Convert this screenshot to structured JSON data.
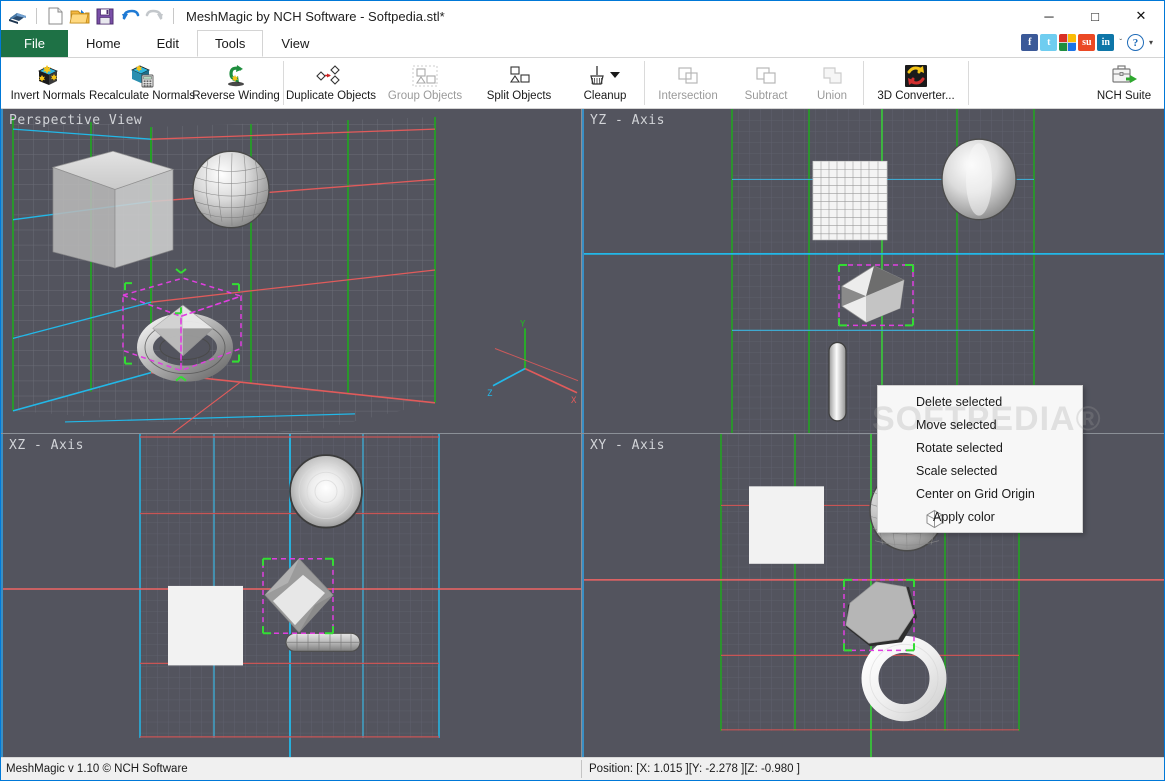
{
  "window": {
    "title": "MeshMagic by NCH Software - Softpedia.stl*",
    "minimize_label": "─",
    "maximize_label": "□",
    "close_label": "✕"
  },
  "quick_access": [
    {
      "name": "app-logo-icon",
      "label": "MeshMagic"
    },
    {
      "name": "new-file-icon",
      "label": "New"
    },
    {
      "name": "open-file-icon",
      "label": "Open"
    },
    {
      "name": "save-file-icon",
      "label": "Save"
    },
    {
      "name": "undo-icon",
      "label": "Undo"
    },
    {
      "name": "redo-icon",
      "label": "Redo"
    }
  ],
  "tabs": [
    {
      "label": "File",
      "active": false,
      "kind": "file"
    },
    {
      "label": "Home",
      "active": false,
      "kind": "normal"
    },
    {
      "label": "Edit",
      "active": false,
      "kind": "normal"
    },
    {
      "label": "Tools",
      "active": true,
      "kind": "normal"
    },
    {
      "label": "View",
      "active": false,
      "kind": "normal"
    }
  ],
  "social_buttons": [
    {
      "name": "facebook-icon",
      "label": "f"
    },
    {
      "name": "twitter-icon",
      "label": "t"
    },
    {
      "name": "googleplus-icon",
      "label": "+"
    },
    {
      "name": "stumbleupon-icon",
      "label": "su"
    },
    {
      "name": "linkedin-icon",
      "label": "in"
    }
  ],
  "social_overflow_label": "ˇ",
  "help_label": "?",
  "help_dropdown_label": "▾",
  "ribbon": {
    "groups": [
      {
        "name": "normals-group",
        "items": [
          {
            "label": "Invert Normals",
            "icon": "invert-normals-icon",
            "disabled": false
          },
          {
            "label": "Recalculate Normals",
            "icon": "recalculate-normals-icon",
            "disabled": false
          },
          {
            "label": "Reverse Winding",
            "icon": "reverse-winding-icon",
            "disabled": false
          }
        ]
      },
      {
        "name": "objects-group",
        "items": [
          {
            "label": "Duplicate Objects",
            "icon": "duplicate-objects-icon",
            "disabled": false
          },
          {
            "label": "Group Objects",
            "icon": "group-objects-icon",
            "disabled": true
          },
          {
            "label": "Split Objects",
            "icon": "split-objects-icon",
            "disabled": false
          },
          {
            "label": "Cleanup",
            "icon": "cleanup-icon",
            "disabled": false,
            "dropdown": true
          }
        ]
      },
      {
        "name": "boolean-group",
        "items": [
          {
            "label": "Intersection",
            "icon": "intersection-icon",
            "disabled": true
          },
          {
            "label": "Subtract",
            "icon": "subtract-icon",
            "disabled": true
          },
          {
            "label": "Union",
            "icon": "union-icon",
            "disabled": true
          }
        ]
      },
      {
        "name": "converter-group",
        "items": [
          {
            "label": "3D Converter...",
            "icon": "3d-converter-icon",
            "disabled": false
          }
        ]
      }
    ],
    "right": {
      "label": "NCH Suite",
      "icon": "nch-suite-icon"
    }
  },
  "viewports": [
    {
      "label": "Perspective View",
      "name": "viewport-perspective"
    },
    {
      "label": "YZ - Axis",
      "name": "viewport-yz"
    },
    {
      "label": "XZ - Axis",
      "name": "viewport-xz"
    },
    {
      "label": "XY - Axis",
      "name": "viewport-xy"
    }
  ],
  "context_menu": {
    "watermark": "SOFTPEDIA®",
    "items": [
      {
        "label": "Delete selected",
        "icon": null
      },
      {
        "label": "Move selected",
        "icon": null
      },
      {
        "label": "Rotate selected",
        "icon": null
      },
      {
        "label": "Scale selected",
        "icon": null
      },
      {
        "label": "Center on Grid Origin",
        "icon": null
      },
      {
        "label": "Apply color",
        "icon": "cube-color-icon"
      }
    ]
  },
  "statusbar": {
    "left": "MeshMagic v 1.10 © NCH Software",
    "right": "Position: [X: 1.015 ][Y: -2.278 ][Z: -0.980 ]"
  },
  "colors": {
    "file_tab_green": "#1e7145",
    "viewport_bg": "#53545e",
    "axis_x_red": "#e05b5b",
    "axis_y_green": "#22bb22",
    "axis_z_cyan": "#22b8e8",
    "selection_magenta": "#e03fe0",
    "selection_handle_green": "#33dd33",
    "window_border_blue": "#0078d7"
  }
}
